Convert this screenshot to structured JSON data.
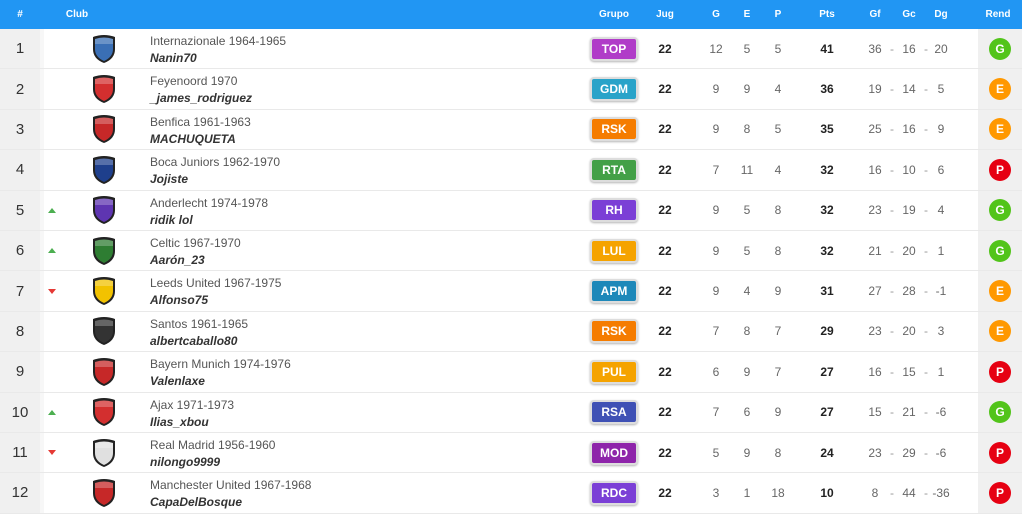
{
  "header": {
    "rank": "#",
    "club": "Club",
    "group": "Grupo",
    "played": "Jug",
    "won": "G",
    "drawn": "E",
    "lost": "P",
    "points": "Pts",
    "gf": "Gf",
    "gc": "Gc",
    "dg": "Dg",
    "form": "Rend"
  },
  "colors": {
    "header_bg": "#2196f3",
    "form_G": "#52c41a",
    "form_E": "#ff9800",
    "form_P": "#e60012"
  },
  "rows": [
    {
      "rank": "1",
      "trend": "",
      "club": "Internazionale 1964-1965",
      "user": "Nanin70",
      "group": "TOP",
      "group_color": "#b03cc8",
      "shield": "#3a6fb5",
      "played": "22",
      "won": "12",
      "drawn": "5",
      "lost": "5",
      "points": "41",
      "gf": "36",
      "gc": "16",
      "dg": "20",
      "form": "G"
    },
    {
      "rank": "2",
      "trend": "",
      "club": "Feyenoord 1970",
      "user": "_james_rodriguez",
      "group": "GDM",
      "group_color": "#29a3c9",
      "shield": "#d32f2f",
      "played": "22",
      "won": "9",
      "drawn": "9",
      "lost": "4",
      "points": "36",
      "gf": "19",
      "gc": "14",
      "dg": "5",
      "form": "E"
    },
    {
      "rank": "3",
      "trend": "",
      "club": "Benfica 1961-1963",
      "user": "MACHUQUETA",
      "group": "RSK",
      "group_color": "#f57c00",
      "shield": "#c62828",
      "played": "22",
      "won": "9",
      "drawn": "8",
      "lost": "5",
      "points": "35",
      "gf": "25",
      "gc": "16",
      "dg": "9",
      "form": "E"
    },
    {
      "rank": "4",
      "trend": "",
      "club": "Boca Juniors 1962-1970",
      "user": "Jojiste",
      "group": "RTA",
      "group_color": "#43a047",
      "shield": "#1e3f8c",
      "played": "22",
      "won": "7",
      "drawn": "11",
      "lost": "4",
      "points": "32",
      "gf": "16",
      "gc": "10",
      "dg": "6",
      "form": "P"
    },
    {
      "rank": "5",
      "trend": "up",
      "club": "Anderlecht 1974-1978",
      "user": "ridik lol",
      "group": "RH",
      "group_color": "#7b3fd6",
      "shield": "#5e35b1",
      "played": "22",
      "won": "9",
      "drawn": "5",
      "lost": "8",
      "points": "32",
      "gf": "23",
      "gc": "19",
      "dg": "4",
      "form": "G"
    },
    {
      "rank": "6",
      "trend": "up",
      "club": "Celtic 1967-1970",
      "user": "Aarón_23",
      "group": "LUL",
      "group_color": "#f5a300",
      "shield": "#2e7d32",
      "played": "22",
      "won": "9",
      "drawn": "5",
      "lost": "8",
      "points": "32",
      "gf": "21",
      "gc": "20",
      "dg": "1",
      "form": "G"
    },
    {
      "rank": "7",
      "trend": "down",
      "club": "Leeds United 1967-1975",
      "user": "Alfonso75",
      "group": "APM",
      "group_color": "#1e88b9",
      "shield": "#f2c200",
      "played": "22",
      "won": "9",
      "drawn": "4",
      "lost": "9",
      "points": "31",
      "gf": "27",
      "gc": "28",
      "dg": "-1",
      "form": "E"
    },
    {
      "rank": "8",
      "trend": "",
      "club": "Santos 1961-1965",
      "user": "albertcaballo80",
      "group": "RSK",
      "group_color": "#f57c00",
      "shield": "#333333",
      "played": "22",
      "won": "7",
      "drawn": "8",
      "lost": "7",
      "points": "29",
      "gf": "23",
      "gc": "20",
      "dg": "3",
      "form": "E"
    },
    {
      "rank": "9",
      "trend": "",
      "club": "Bayern Munich 1974-1976",
      "user": "Valenlaxe",
      "group": "PUL",
      "group_color": "#f5a300",
      "shield": "#c62828",
      "played": "22",
      "won": "6",
      "drawn": "9",
      "lost": "7",
      "points": "27",
      "gf": "16",
      "gc": "15",
      "dg": "1",
      "form": "P"
    },
    {
      "rank": "10",
      "trend": "up",
      "club": "Ajax 1971-1973",
      "user": "Ilias_xbou",
      "group": "RSA",
      "group_color": "#3f51b5",
      "shield": "#d32f2f",
      "played": "22",
      "won": "7",
      "drawn": "6",
      "lost": "9",
      "points": "27",
      "gf": "15",
      "gc": "21",
      "dg": "-6",
      "form": "G"
    },
    {
      "rank": "11",
      "trend": "down",
      "club": "Real Madrid 1956-1960",
      "user": "nilongo9999",
      "group": "MOD",
      "group_color": "#8e24aa",
      "shield": "#e0e0e0",
      "played": "22",
      "won": "5",
      "drawn": "9",
      "lost": "8",
      "points": "24",
      "gf": "23",
      "gc": "29",
      "dg": "-6",
      "form": "P"
    },
    {
      "rank": "12",
      "trend": "",
      "club": "Manchester United 1967-1968",
      "user": "CapaDelBosque",
      "group": "RDC",
      "group_color": "#7b3fd6",
      "shield": "#c62828",
      "played": "22",
      "won": "3",
      "drawn": "1",
      "lost": "18",
      "points": "10",
      "gf": "8",
      "gc": "44",
      "dg": "-36",
      "form": "P"
    }
  ]
}
